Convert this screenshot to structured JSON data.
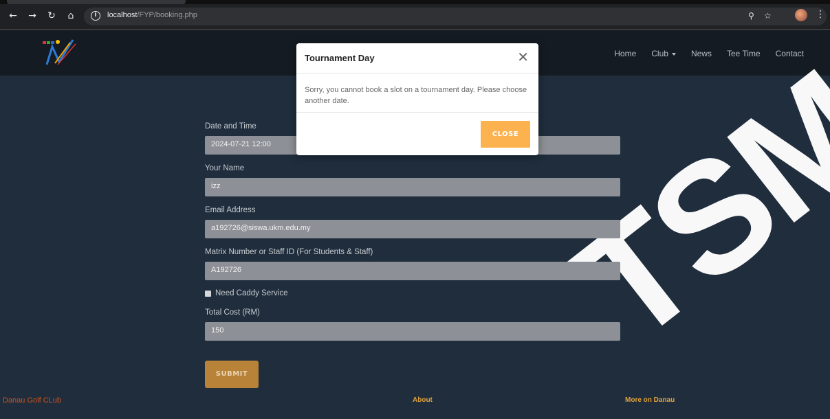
{
  "browser": {
    "url_host": "localhost",
    "url_path": "/FYP/booking.php"
  },
  "nav": {
    "items": [
      {
        "label": "Home"
      },
      {
        "label": "Club"
      },
      {
        "label": "News"
      },
      {
        "label": "Tee Time"
      },
      {
        "label": "Contact"
      }
    ]
  },
  "form": {
    "datetime_label": "Date and Time",
    "datetime_value": "2024-07-21 12:00",
    "name_label": "Your Name",
    "name_value": "izz",
    "email_label": "Email Address",
    "email_value": "a192726@siswa.ukm.edu.my",
    "id_label": "Matrix Number or Staff ID (For Students & Staff)",
    "id_value": "A192726",
    "caddy_label": "Need Caddy Service",
    "cost_label": "Total Cost (RM)",
    "cost_value": "150",
    "submit_label": "SUBMIT"
  },
  "footer": {
    "brand": "Danau Golf CLub",
    "about": "About",
    "more": "More on Danau"
  },
  "watermark": "TSM",
  "modal": {
    "title": "Tournament Day",
    "message": "Sorry, you cannot book a slot on a tournament day. Please choose another date.",
    "close_label": "CLOSE"
  },
  "colors": {
    "accent": "#fbb24f",
    "submit": "#b88339",
    "footer_brand": "#d2541c",
    "footer_heading": "#e0a23c"
  }
}
